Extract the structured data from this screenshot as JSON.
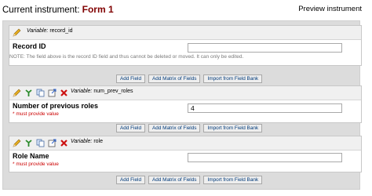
{
  "header": {
    "prefix": "Current instrument:",
    "form_name": "Form 1",
    "preview_label": "Preview instrument"
  },
  "fields": [
    {
      "variable_label": "Variable:",
      "variable_name": "record_id",
      "field_label": "Record ID",
      "value": "",
      "required_note": "",
      "note": "NOTE: The field above is the record ID field and thus cannot be deleted or moved. It can only be edited."
    },
    {
      "variable_label": "Variable:",
      "variable_name": "num_prev_roles",
      "field_label": "Number of previous roles",
      "value": "4",
      "required_note": "* must provide value"
    },
    {
      "variable_label": "Variable:",
      "variable_name": "role",
      "field_label": "Role Name",
      "value": "",
      "required_note": "* must provide value"
    }
  ],
  "buttons": {
    "add_field": "Add Field",
    "add_matrix": "Add Matrix of Fields",
    "import_bank": "Import from Field Bank"
  },
  "icons": [
    "pencil-icon",
    "branching-icon",
    "copy-icon",
    "move-icon",
    "delete-icon"
  ],
  "colors": {
    "form_name": "#800000",
    "required": "#cc0000",
    "panel": "#dcdcdc",
    "button_text": "#003a7a"
  }
}
